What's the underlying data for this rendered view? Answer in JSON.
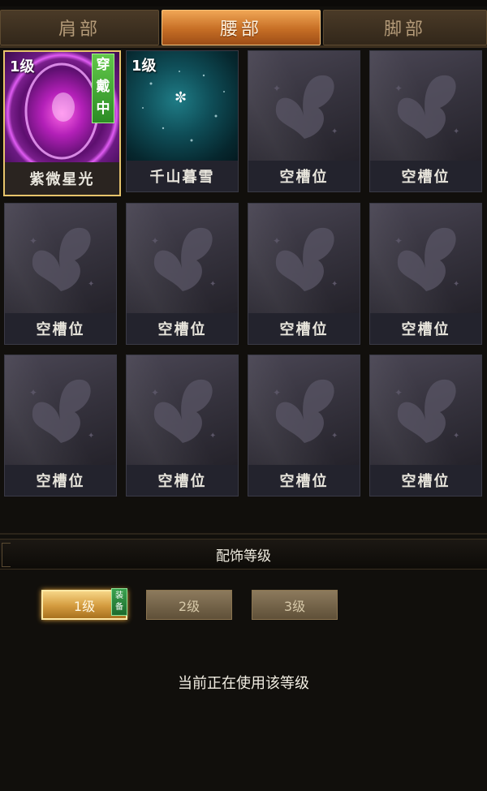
{
  "tabs": [
    {
      "label": "肩部",
      "active": false
    },
    {
      "label": "腰部",
      "active": true
    },
    {
      "label": "脚部",
      "active": false
    }
  ],
  "slots": [
    {
      "name": "紫微星光",
      "level": "1级",
      "badge": "穿戴中",
      "type": "purple"
    },
    {
      "name": "千山暮雪",
      "level": "1级",
      "badge": "",
      "type": "teal"
    },
    {
      "name": "空槽位"
    },
    {
      "name": "空槽位"
    },
    {
      "name": "空槽位"
    },
    {
      "name": "空槽位"
    },
    {
      "name": "空槽位"
    },
    {
      "name": "空槽位"
    },
    {
      "name": "空槽位"
    },
    {
      "name": "空槽位"
    },
    {
      "name": "空槽位"
    },
    {
      "name": "空槽位"
    }
  ],
  "section": {
    "title": "配饰等级"
  },
  "levels": [
    {
      "label": "1级",
      "active": true
    },
    {
      "label": "2级",
      "active": false
    },
    {
      "label": "3级",
      "active": false
    }
  ],
  "equip_tag": "装备",
  "status_text": "当前正在使用该等级",
  "colors": {
    "accent": "#d39a3e",
    "active_tab": "#c66e25",
    "badge_green": "#2c8c25"
  }
}
